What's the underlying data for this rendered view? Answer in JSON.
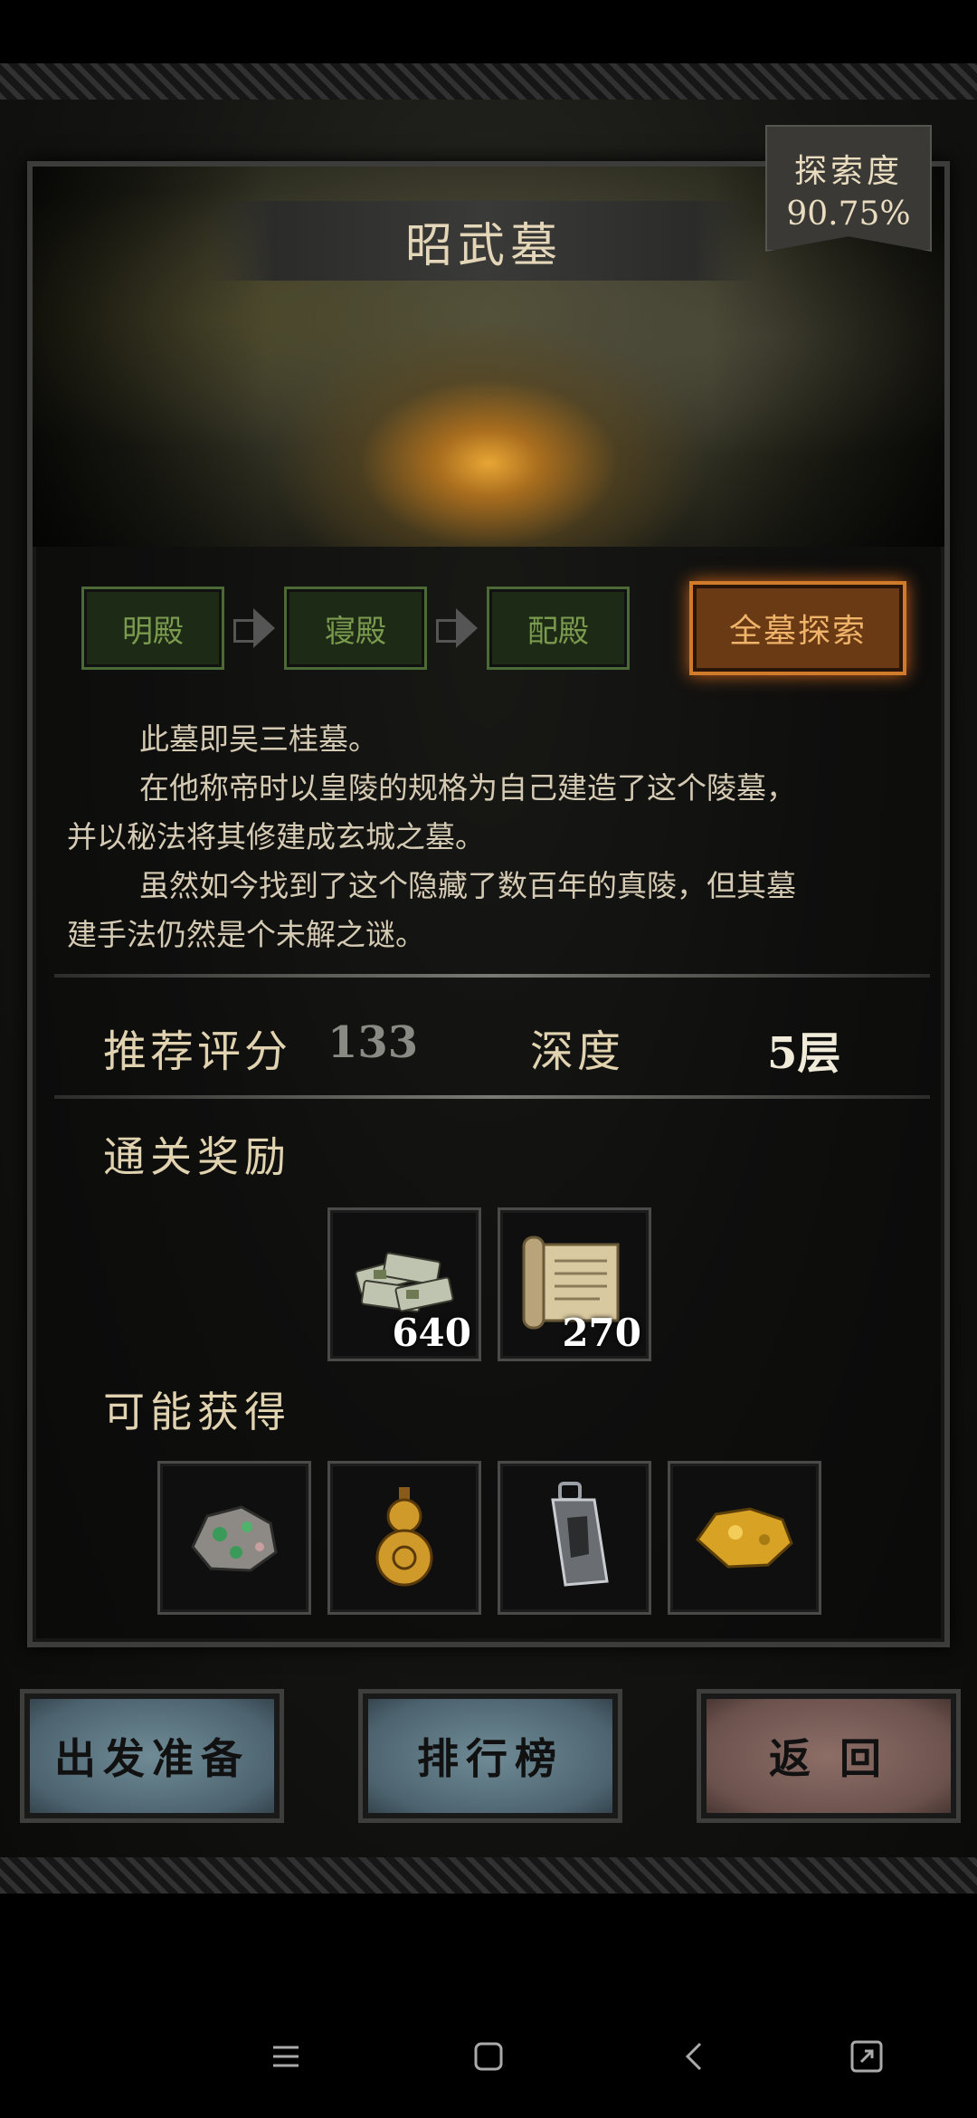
{
  "tomb": {
    "title": "昭武墓",
    "explore_label": "探索度",
    "explore_value": "90.75%",
    "progress_fraction": 0.9075
  },
  "route": {
    "steps": [
      "明殿",
      "寝殿",
      "配殿"
    ],
    "full_explore": "全墓探索"
  },
  "description": {
    "p1": "此墓即吴三桂墓。",
    "p2a": "在他称帝时以皇陵的规格为自己建造了这个陵墓，",
    "p2b": "并以秘法将其修建成玄城之墓。",
    "p3a": "虽然如今找到了这个隐藏了数百年的真陵，但其墓",
    "p3b": "建手法仍然是个未解之谜。"
  },
  "stats": {
    "rec_label": "推荐评分",
    "rec_value": "133",
    "depth_label": "深度",
    "depth_value": "5层"
  },
  "rewards": {
    "title": "通关奖励",
    "items": [
      {
        "icon": "money-bundle-icon",
        "qty": "640"
      },
      {
        "icon": "scroll-icon",
        "qty": "270"
      }
    ]
  },
  "drops": {
    "title": "可能获得",
    "items": [
      {
        "icon": "jade-ore-icon"
      },
      {
        "icon": "gourd-icon"
      },
      {
        "icon": "blade-talisman-icon"
      },
      {
        "icon": "gold-nugget-icon"
      }
    ]
  },
  "buttons": {
    "prepare": "出发准备",
    "ranking": "排行榜",
    "back": "返 回"
  },
  "colors": {
    "accent_orange": "#d07a2c",
    "route_green": "#4c6a36",
    "button_blue": "#4d6470",
    "button_red": "#6c524d"
  },
  "navbar": {
    "icons": [
      "menu-icon",
      "home-icon",
      "back-icon",
      "screenshot-icon"
    ]
  }
}
